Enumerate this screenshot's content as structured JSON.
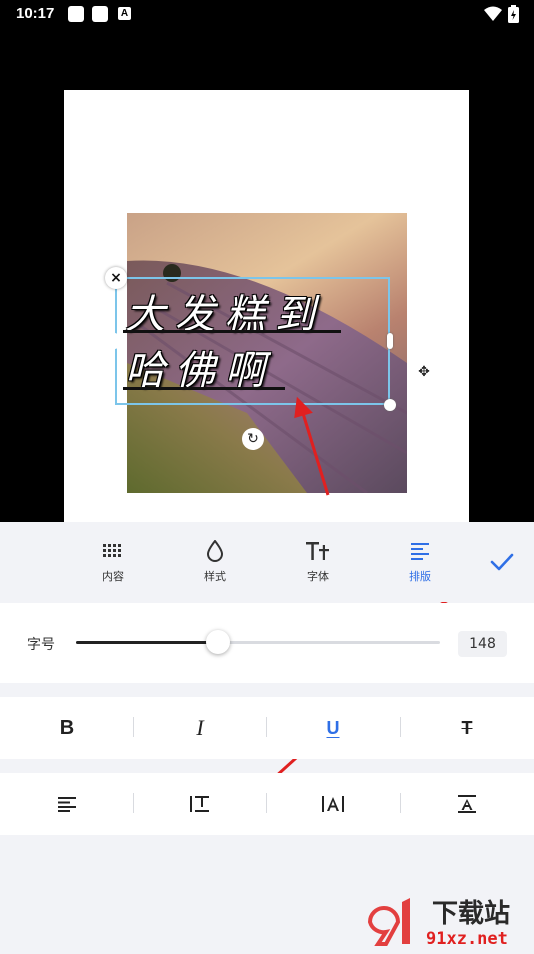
{
  "status_bar": {
    "time": "10:17"
  },
  "canvas": {
    "text_lines": [
      "大发糕到",
      "哈佛啊"
    ]
  },
  "tabs": [
    {
      "label": "内容",
      "icon": "grid-dots-icon",
      "active": false
    },
    {
      "label": "样式",
      "icon": "droplet-icon",
      "active": false
    },
    {
      "label": "字体",
      "icon": "font-tt-icon",
      "active": false
    },
    {
      "label": "排版",
      "icon": "align-lines-icon",
      "active": true
    }
  ],
  "font_size": {
    "label": "字号",
    "value": "148",
    "level": 0.39
  },
  "style_buttons": [
    {
      "name": "bold",
      "label": "B"
    },
    {
      "name": "italic",
      "label": "I"
    },
    {
      "name": "underline",
      "label": "U",
      "active": true
    },
    {
      "name": "strikethrough",
      "label": "T"
    }
  ],
  "layout_buttons": [
    {
      "name": "align-left",
      "icon": "align-left-icon"
    },
    {
      "name": "line-spacing",
      "icon": "line-spacing-icon"
    },
    {
      "name": "letter-spacing",
      "icon": "letter-spacing-icon"
    },
    {
      "name": "text-baseline",
      "icon": "text-baseline-icon"
    }
  ],
  "watermark": {
    "brand": "下载站",
    "url": "91xz.net"
  },
  "colors": {
    "accent": "#2f6fe6",
    "selection": "#7cc5ea",
    "arrow": "#e02020"
  }
}
